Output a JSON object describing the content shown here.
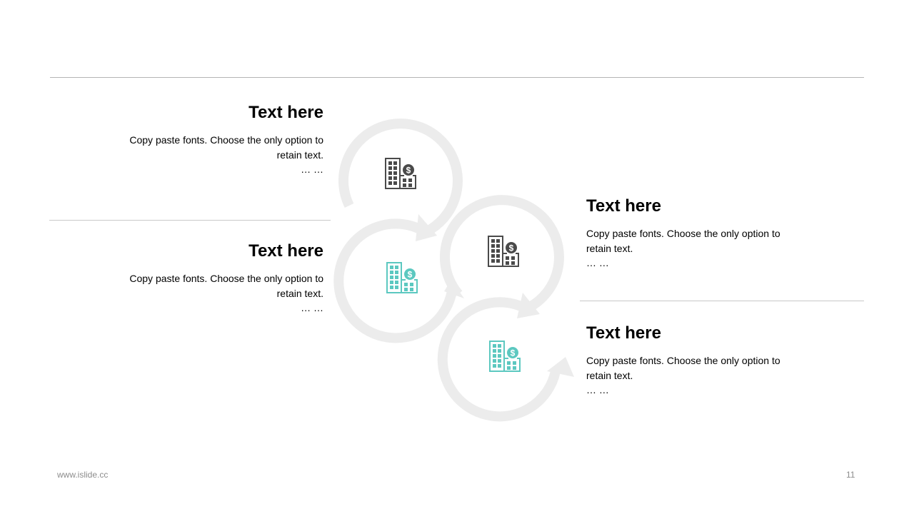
{
  "items": [
    {
      "title": "Text here",
      "body": "Copy paste fonts. Choose the only option to retain text.",
      "ellipsis": "… …"
    },
    {
      "title": "Text here",
      "body": "Copy paste fonts. Choose the only option to retain text.",
      "ellipsis": "… …"
    },
    {
      "title": "Text here",
      "body": "Copy paste fonts. Choose the only option to retain text.",
      "ellipsis": "… …"
    },
    {
      "title": "Text here",
      "body": "Copy paste fonts. Choose the only option to retain text.",
      "ellipsis": "… …"
    }
  ],
  "icons": [
    "building-dollar-icon",
    "building-dollar-icon",
    "building-dollar-icon",
    "building-dollar-icon"
  ],
  "colors": {
    "ring": "#ececec",
    "dark_icon": "#4a4a4a",
    "teal_icon": "#5cc8c0",
    "rule": "#c9c9c9"
  },
  "footer": {
    "url": "www.islide.cc",
    "page": "11"
  }
}
